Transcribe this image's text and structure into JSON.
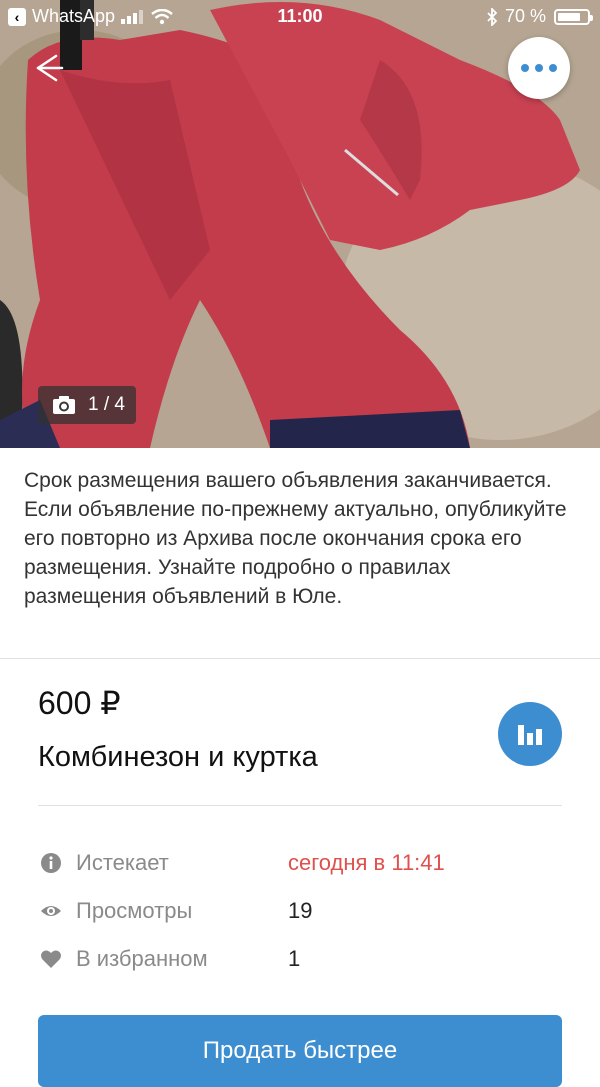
{
  "status_bar": {
    "back_app": "WhatsApp",
    "time": "11:00",
    "battery": "70 %"
  },
  "gallery": {
    "counter": "1 / 4"
  },
  "notice": "Срок размещения вашего объявления заканчивается. Если объявление по-прежнему актуально, опубликуйте его повторно из Архива после окончания срока его размещения. Узнайте подробно о правилах размещения объявлений в Юле.",
  "listing": {
    "price": "600 ₽",
    "title": "Комбинезон и куртка"
  },
  "details": [
    {
      "icon": "info-icon",
      "label": "Истекает",
      "value": "сегодня в 11:41"
    },
    {
      "icon": "eye-icon",
      "label": "Просмотры",
      "value": "19"
    },
    {
      "icon": "heart-icon",
      "label": "В избранном",
      "value": "1"
    }
  ],
  "cta_label": "Продать быстрее",
  "colors": {
    "accent": "#3d8ed1",
    "expiry_red": "#e0504d"
  }
}
